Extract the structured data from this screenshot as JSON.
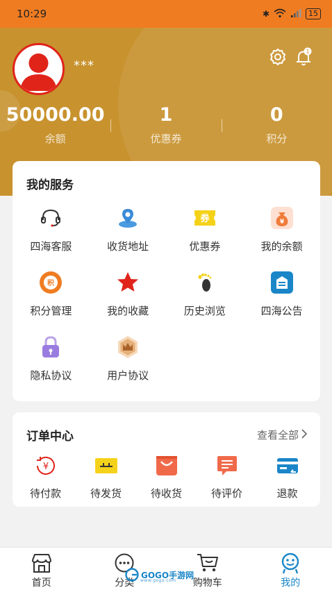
{
  "status_bar": {
    "time": "10:29",
    "battery": "15"
  },
  "profile": {
    "name": "***",
    "notification_count": "1"
  },
  "stats": [
    {
      "value": "50000.00",
      "label": "余额"
    },
    {
      "value": "1",
      "label": "优惠券"
    },
    {
      "value": "0",
      "label": "积分"
    }
  ],
  "services": {
    "title": "我的服务",
    "items": [
      {
        "label": "四海客服",
        "icon": "headset-icon"
      },
      {
        "label": "收货地址",
        "icon": "location-pin-icon"
      },
      {
        "label": "优惠券",
        "icon": "coupon-icon",
        "icon_text": "券"
      },
      {
        "label": "我的余额",
        "icon": "money-bag-icon",
        "icon_text": "¥"
      },
      {
        "label": "积分管理",
        "icon": "points-icon",
        "icon_text": "积"
      },
      {
        "label": "我的收藏",
        "icon": "star-icon"
      },
      {
        "label": "历史浏览",
        "icon": "footprint-icon"
      },
      {
        "label": "四海公告",
        "icon": "notice-icon"
      },
      {
        "label": "隐私协议",
        "icon": "lock-icon"
      },
      {
        "label": "用户协议",
        "icon": "crown-badge-icon"
      }
    ]
  },
  "orders": {
    "title": "订单中心",
    "view_all": "查看全部",
    "items": [
      {
        "label": "待付款",
        "icon": "yen-circle-icon",
        "icon_text": "¥"
      },
      {
        "label": "待发货",
        "icon": "package-icon"
      },
      {
        "label": "待收货",
        "icon": "shopping-bag-icon"
      },
      {
        "label": "待评价",
        "icon": "comment-icon"
      },
      {
        "label": "退款",
        "icon": "refund-card-icon"
      }
    ]
  },
  "tabbar": [
    {
      "label": "首页",
      "icon": "storefront-icon"
    },
    {
      "label": "分类",
      "icon": "chat-dots-icon"
    },
    {
      "label": "购物车",
      "icon": "cart-icon"
    },
    {
      "label": "我的",
      "icon": "smiley-person-icon"
    }
  ],
  "watermark": {
    "text": "GOGO手游网",
    "sub": "www.gogo.com"
  },
  "colors": {
    "header": "#c8922e",
    "status_bar": "#f07c22",
    "accent_red": "#e0241a",
    "active_tab": "#1a86c8"
  }
}
